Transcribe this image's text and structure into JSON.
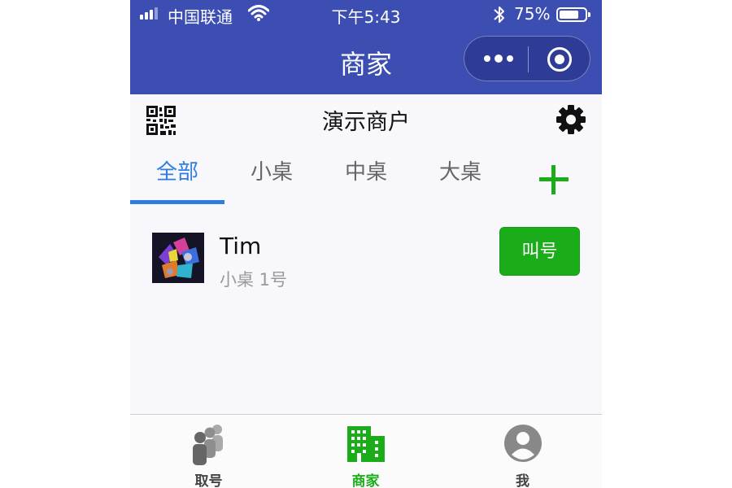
{
  "status_bar": {
    "carrier": "中国联通",
    "time": "下午5:43",
    "battery_percent": "75%",
    "battery_level": 0.75
  },
  "nav": {
    "title": "商家",
    "capsule_icons": [
      "more-icon",
      "close-miniprogram-icon"
    ]
  },
  "header": {
    "merchant_name": "演示商户",
    "left_icon": "qr-code-icon",
    "right_icon": "gear-icon"
  },
  "tabs": {
    "items": [
      {
        "label": "全部",
        "active": true
      },
      {
        "label": "小桌",
        "active": false
      },
      {
        "label": "中桌",
        "active": false
      },
      {
        "label": "大桌",
        "active": false
      }
    ],
    "add_icon": "plus-icon"
  },
  "queue": [
    {
      "name": "Tim",
      "detail": "小桌 1号",
      "action": "叫号"
    }
  ],
  "tabbar": {
    "items": [
      {
        "label": "取号",
        "icon": "people-icon",
        "active": false
      },
      {
        "label": "商家",
        "icon": "building-icon",
        "active": true
      },
      {
        "label": "我",
        "icon": "user-icon",
        "active": false
      }
    ]
  },
  "colors": {
    "nav_bg": "#3c4eb2",
    "accent_blue": "#2e7de0",
    "accent_green": "#1aad19",
    "page_bg": "#f8f7fb"
  }
}
